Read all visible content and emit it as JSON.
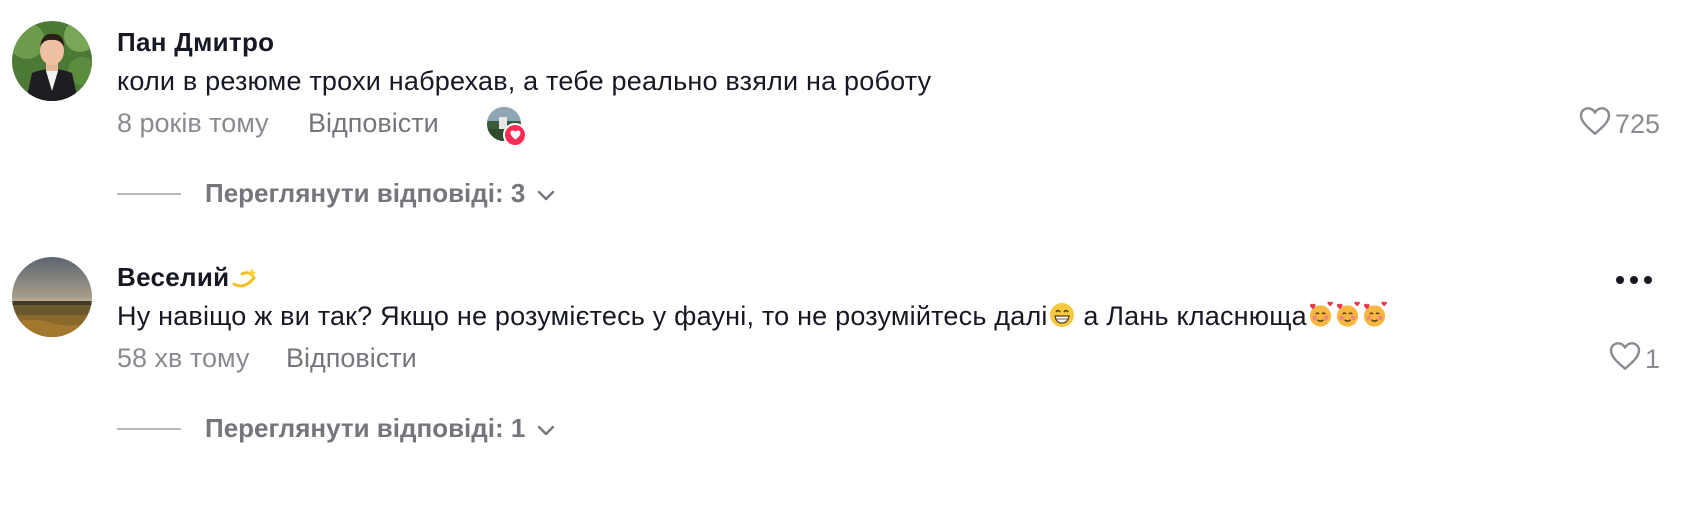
{
  "comments": [
    {
      "username": "Пан Дмитро",
      "text": "коли в резюме трохи набрехав, а тебе реально взяли на роботу",
      "time": "8 років тому",
      "reply_label": "Відповісти",
      "likes": "725",
      "view_replies": "Переглянути відповіді: 3"
    },
    {
      "username": "Веселий",
      "text_part1": "Ну навіщо ж ви так? Якщо не розумієтесь у фауні, то не розумійтесь далі",
      "text_part2": " а Лань класнюща",
      "time": "58 хв тому",
      "reply_label": "Відповісти",
      "likes": "1",
      "view_replies": "Переглянути відповіді: 1"
    }
  ],
  "icons": {
    "like": "heart-outline-icon",
    "more": "more-dots-icon",
    "expand": "chevron-down-icon",
    "creator_liked": "heart-badge-icon"
  },
  "colors": {
    "secondary_text": "#8a8b91",
    "heart_badge": "#fe2c55"
  }
}
